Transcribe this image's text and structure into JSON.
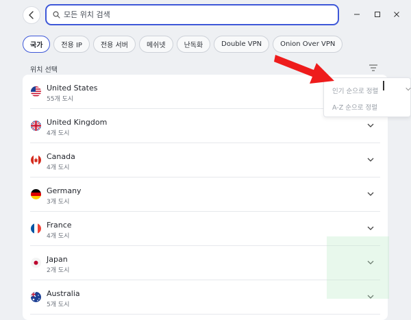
{
  "search": {
    "placeholder": "모든 위치 검색"
  },
  "tabs": [
    {
      "label": "국가",
      "active": true
    },
    {
      "label": "전용 IP",
      "active": false
    },
    {
      "label": "전용 서버",
      "active": false
    },
    {
      "label": "메쉬넷",
      "active": false
    },
    {
      "label": "난독화",
      "active": false
    },
    {
      "label": "Double VPN",
      "active": false
    },
    {
      "label": "Onion Over VPN",
      "active": false
    }
  ],
  "section": {
    "label": "위치 선택"
  },
  "sort_menu": {
    "items": [
      "인기 순으로 정렬",
      "A-Z 순으로 정렬"
    ]
  },
  "countries": [
    {
      "name": "United States",
      "cities": "55개 도시",
      "flag": "us-flag-icon"
    },
    {
      "name": "United Kingdom",
      "cities": "4개 도시",
      "flag": "uk-flag-icon"
    },
    {
      "name": "Canada",
      "cities": "4개 도시",
      "flag": "canada-flag-icon"
    },
    {
      "name": "Germany",
      "cities": "3개 도시",
      "flag": "germany-flag-icon"
    },
    {
      "name": "France",
      "cities": "4개 도시",
      "flag": "france-flag-icon"
    },
    {
      "name": "Japan",
      "cities": "2개 도시",
      "flag": "japan-flag-icon"
    },
    {
      "name": "Australia",
      "cities": "5개 도시",
      "flag": "australia-flag-icon"
    }
  ],
  "colors": {
    "accent": "#3d57d8",
    "arrow": "#ee1c1c",
    "background": "#eef0f3"
  }
}
